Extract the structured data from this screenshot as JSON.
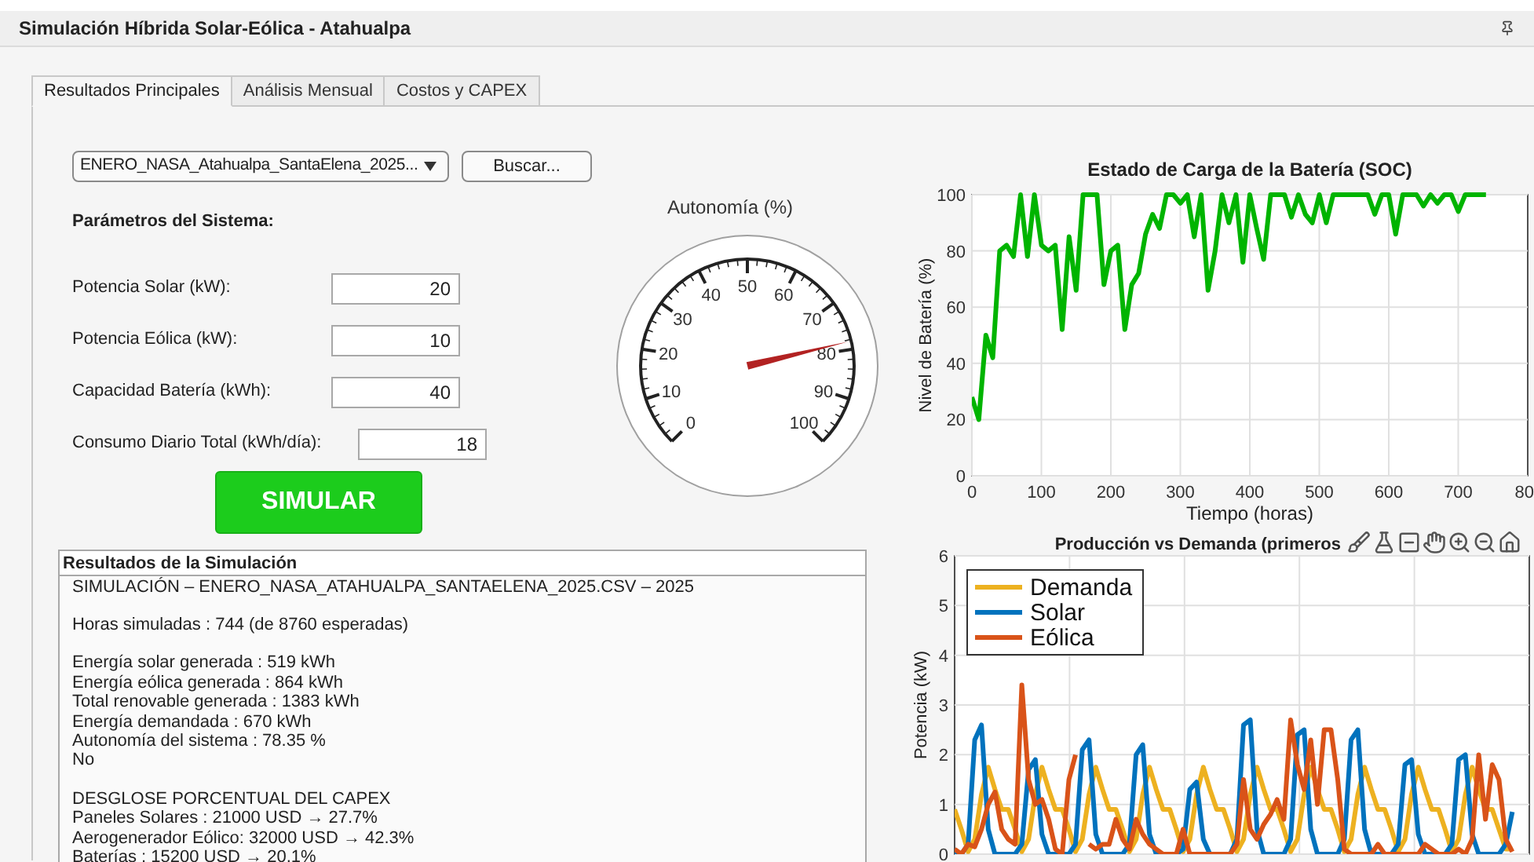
{
  "window": {
    "title": "Simulación Híbrida Solar-Eólica - Atahualpa"
  },
  "tabs": [
    {
      "label": "Resultados Principales",
      "selected": true
    },
    {
      "label": "Análisis Mensual",
      "selected": false
    },
    {
      "label": "Costos y CAPEX",
      "selected": false
    }
  ],
  "file_dropdown": {
    "value": "ENERO_NASA_Atahualpa_SantaElena_2025..."
  },
  "browse_button": "Buscar...",
  "parameters": {
    "title": "Parámetros del Sistema:",
    "fields": [
      {
        "label": "Potencia Solar (kW):",
        "value": "20"
      },
      {
        "label": "Potencia Eólica (kW):",
        "value": "10"
      },
      {
        "label": "Capacidad Batería (kWh):",
        "value": "40"
      },
      {
        "label": "Consumo Diario Total (kWh/día):",
        "value": "18"
      }
    ]
  },
  "simulate_button": "SIMULAR",
  "gauge": {
    "title": "Autonomía (%)",
    "ticks": [
      "0",
      "10",
      "20",
      "30",
      "40",
      "50",
      "60",
      "70",
      "80",
      "90",
      "100"
    ]
  },
  "results": {
    "title": "Resultados de la Simulación",
    "paragraphs": [
      [
        "SIMULACIÓN – ENERO_NASA_ATAHUALPA_SANTAELENA_2025.CSV – 2025"
      ],
      [
        "Horas simuladas : 744 (de 8760 esperadas)"
      ],
      [
        "Energía solar generada : 519 kWh",
        "Energía eólica generada : 864 kWh",
        "Total renovable generada : 1383 kWh",
        "Energía demandada : 670 kWh",
        "Autonomía del sistema : 78.35 %",
        "No"
      ],
      [
        "DESGLOSE PORCENTUAL DEL CAPEX",
        "Paneles Solares : 21000 USD → 27.7%",
        "Aerogenerador Eólico: 32000 USD → 42.3%",
        "Baterías : 15200 USD → 20.1%"
      ]
    ]
  },
  "soc_chart": {
    "chart_data": {
      "type": "line",
      "title": "Estado de Carga de la Batería (SOC)",
      "xlabel": "Tiempo (horas)",
      "ylabel": "Nivel de Batería (%)",
      "x": [
        0,
        10,
        20,
        30,
        40,
        50,
        60,
        70,
        80,
        90,
        100,
        110,
        120,
        130,
        140,
        150,
        160,
        170,
        180,
        190,
        200,
        210,
        220,
        230,
        240,
        250,
        260,
        270,
        280,
        290,
        300,
        310,
        320,
        330,
        340,
        350,
        360,
        370,
        380,
        390,
        400,
        410,
        420,
        430,
        440,
        450,
        460,
        470,
        480,
        490,
        500,
        510,
        520,
        530,
        540,
        550,
        560,
        570,
        580,
        590,
        600,
        610,
        620,
        630,
        640,
        650,
        660,
        670,
        680,
        690,
        700,
        710,
        720,
        730,
        740
      ],
      "series": [
        {
          "color": "#00b400",
          "values": [
            28,
            20,
            50,
            42,
            80,
            82,
            78,
            100,
            78,
            100,
            82,
            80,
            82,
            52,
            85,
            66,
            100,
            100,
            100,
            68,
            80,
            82,
            52,
            68,
            72,
            86,
            93,
            88,
            100,
            100,
            97,
            100,
            85,
            100,
            66,
            80,
            100,
            90,
            100,
            76,
            100,
            88,
            77,
            100,
            100,
            100,
            92,
            100,
            93,
            90,
            100,
            90,
            100,
            100,
            100,
            100,
            100,
            100,
            93,
            100,
            100,
            86,
            100,
            100,
            100,
            96,
            100,
            97,
            100,
            100,
            94,
            100,
            100,
            100,
            100
          ]
        }
      ],
      "xlim": [
        0,
        800
      ],
      "ylim": [
        0,
        100
      ],
      "xticks": [
        0,
        100,
        200,
        300,
        400,
        500,
        600,
        700
      ],
      "yticks": [
        0,
        20,
        40,
        60,
        80,
        100
      ],
      "grid": true
    },
    "cut_tick_label": "80"
  },
  "production_chart": {
    "chart_data": {
      "type": "line",
      "title": "Producción vs Demanda (primeros",
      "ylabel": "Potencia (kW)",
      "categories": [
        null,
        null,
        null,
        null,
        null,
        null,
        null,
        null,
        null,
        null,
        null,
        null,
        null,
        null,
        null,
        null,
        null,
        null,
        null,
        null,
        null,
        null,
        null,
        null,
        null,
        null,
        null,
        null,
        null,
        null,
        null,
        null,
        null,
        null,
        null,
        null,
        null,
        null,
        null,
        null,
        null,
        null,
        null,
        null,
        null,
        null,
        null,
        null,
        null,
        null,
        null,
        null,
        null,
        null,
        null,
        null,
        null,
        null,
        null,
        null,
        null,
        null,
        null,
        null,
        null,
        null,
        null,
        null,
        null,
        null,
        null,
        null,
        null,
        null,
        null,
        null,
        null,
        null,
        null,
        null,
        null,
        null,
        null,
        null
      ],
      "series": [
        {
          "name": "Demanda",
          "color": "#edb120",
          "values": [
            0.9,
            0.5,
            0.05,
            0.3,
            1.2,
            1.75,
            1.3,
            0.9,
            0.9,
            0.5,
            0.05,
            0.3,
            1.2,
            1.75,
            1.3,
            0.9,
            0.9,
            0.5,
            0.05,
            0.3,
            1.2,
            1.75,
            1.3,
            0.9,
            0.9,
            0.5,
            0.05,
            0.3,
            1.2,
            1.75,
            1.3,
            0.9,
            0.9,
            0.5,
            0.05,
            0.3,
            1.2,
            1.75,
            1.3,
            0.9,
            0.9,
            0.5,
            0.05,
            0.3,
            1.2,
            1.75,
            1.3,
            0.9,
            0.9,
            0.5,
            0.05,
            0.3,
            1.2,
            1.75,
            1.3,
            0.9,
            0.9,
            0.5,
            0.05,
            0.3,
            1.2,
            1.75,
            1.3,
            0.9,
            0.9,
            0.5,
            0.05,
            0.3,
            1.2,
            1.75,
            1.3,
            0.9,
            0.9,
            0.5,
            0.05,
            0.3,
            1.2,
            1.75,
            1.3,
            0.9,
            0.9,
            0.5,
            0.1,
            0.1
          ]
        },
        {
          "name": "Solar",
          "color": "#0072bd",
          "values": [
            0,
            0,
            0.2,
            2.3,
            2.6,
            0.5,
            0,
            0,
            0,
            0,
            0.2,
            1.7,
            1.9,
            0.4,
            0,
            0,
            0,
            0,
            0.2,
            2.1,
            2.3,
            0.4,
            0,
            0,
            0,
            0,
            0.2,
            2.0,
            2.2,
            0.4,
            0,
            0,
            0,
            0,
            0.1,
            1.3,
            1.45,
            0.3,
            0,
            0,
            0,
            0,
            0.3,
            2.6,
            2.7,
            0.5,
            0,
            0,
            0,
            0,
            0.3,
            2.4,
            2.5,
            0.5,
            0,
            0,
            0,
            0,
            0.3,
            2.3,
            2.5,
            0.5,
            0,
            0,
            0,
            0,
            0.2,
            1.8,
            1.9,
            0.4,
            0,
            0,
            0,
            0,
            0.2,
            1.9,
            2.0,
            0.4,
            0,
            0,
            0,
            0,
            0.2,
            0.85
          ]
        },
        {
          "name": "Eólica",
          "color": "#d95319",
          "values": [
            0.1,
            0,
            0.2,
            0.15,
            0.5,
            1.0,
            1.25,
            0.5,
            0.3,
            0.2,
            3.4,
            1.5,
            1.0,
            1.1,
            0.7,
            0.1,
            0,
            1.5,
            2.0,
            null,
            0.2,
            0.1,
            0.2,
            0.2,
            0.7,
            0.3,
            0.1,
            0.7,
            0.4,
            0.2,
            0.1,
            0,
            0,
            0,
            0.5,
            0,
            0,
            0,
            0,
            0,
            0,
            0,
            0.2,
            1.5,
            0.5,
            0.3,
            0.6,
            0.8,
            1.1,
            0.7,
            2.7,
            1.8,
            1.3,
            2.3,
            1.0,
            2.5,
            2.5,
            1.5,
            0.1,
            0,
            0,
            0,
            0,
            0.2,
            0,
            0,
            0,
            0,
            0,
            0,
            0.2,
            0.1,
            0,
            0,
            0,
            0.1,
            0,
            0.3,
            2.0,
            0.7,
            1.8,
            1.5,
            0.3,
            0.05
          ]
        }
      ],
      "ylim": [
        0,
        6
      ],
      "yticks": [
        0,
        1,
        2,
        3,
        4,
        5,
        6
      ],
      "grid": true,
      "legend": true
    }
  }
}
